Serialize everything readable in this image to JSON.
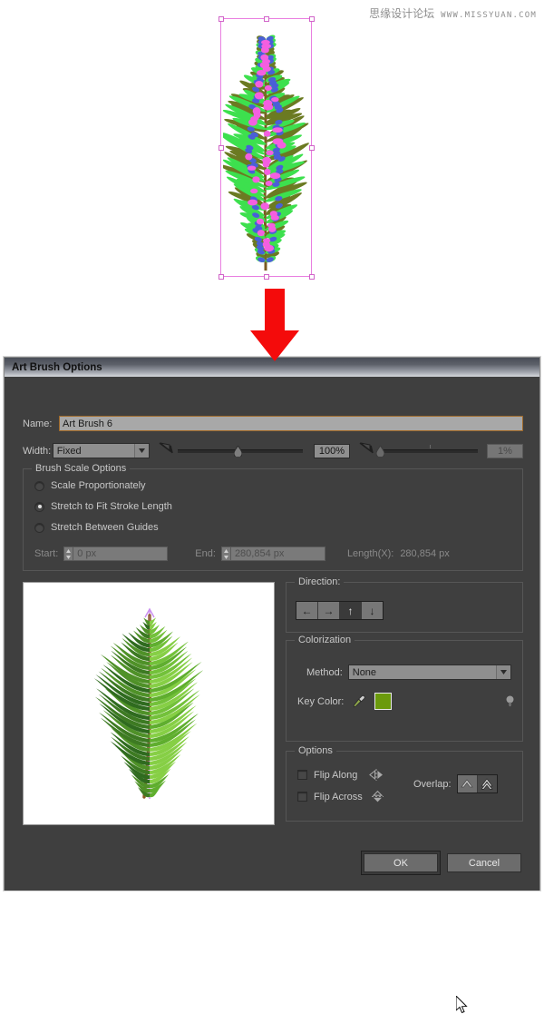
{
  "watermark": {
    "cn_text": "思缘设计论坛",
    "url_text": "WWW.MISSYUAN.COM"
  },
  "artwork": {
    "name": "selected-plant-artwork",
    "selection_color": "#e97fe0"
  },
  "arrow": {
    "color": "#f40b0b",
    "direction": "down"
  },
  "dialog": {
    "title": "Art Brush Options",
    "name_label": "Name:",
    "name_value": "Art Brush 6",
    "width_label": "Width:",
    "width_value": "Fixed",
    "width_percent": "100%",
    "width_variation": "1%",
    "scale_group": {
      "title": "Brush Scale Options",
      "options": [
        {
          "label": "Scale Proportionately",
          "selected": false
        },
        {
          "label": "Stretch to Fit Stroke Length",
          "selected": true
        },
        {
          "label": "Stretch Between Guides",
          "selected": false
        }
      ],
      "start_label": "Start:",
      "start_value": "0 px",
      "end_label": "End:",
      "end_value": "280,854 px",
      "length_label": "Length(X):",
      "length_value": "280,854 px"
    },
    "direction_group": {
      "title": "Direction:",
      "buttons": [
        {
          "name": "direction-left",
          "glyph": "←",
          "selected": false
        },
        {
          "name": "direction-right",
          "glyph": "→",
          "selected": false
        },
        {
          "name": "direction-up",
          "glyph": "↑",
          "selected": true
        },
        {
          "name": "direction-down",
          "glyph": "↓",
          "selected": false
        }
      ]
    },
    "colorization_group": {
      "title": "Colorization",
      "method_label": "Method:",
      "method_value": "None",
      "key_color_label": "Key Color:",
      "key_color_hex": "#6b9a0c"
    },
    "options_group": {
      "title": "Options",
      "flip_along_label": "Flip Along",
      "flip_along_checked": false,
      "flip_across_label": "Flip Across",
      "flip_across_checked": false,
      "overlap_label": "Overlap:",
      "overlap_buttons": [
        {
          "name": "overlap-allow",
          "selected": false
        },
        {
          "name": "overlap-prevent",
          "selected": true
        }
      ]
    },
    "footer": {
      "ok_label": "OK",
      "cancel_label": "Cancel"
    }
  }
}
